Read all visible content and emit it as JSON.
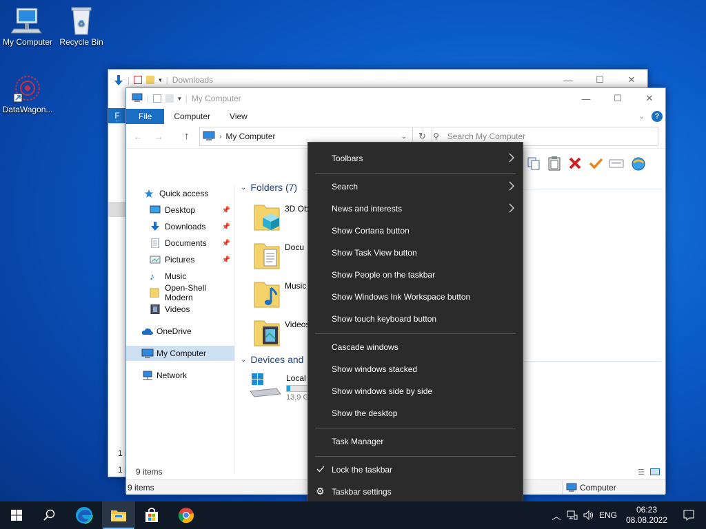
{
  "desktop": {
    "icons": [
      {
        "label": "My Computer"
      },
      {
        "label": "Recycle Bin"
      },
      {
        "label": "DataWagon..."
      }
    ]
  },
  "back_window": {
    "title": "Downloads",
    "tab_file_partial": "F",
    "status": "1 ite",
    "status2": "1 i"
  },
  "explorer": {
    "title": "My Computer",
    "tabs": [
      "File",
      "Computer",
      "View"
    ],
    "address_path": "My Computer",
    "search_placeholder": "Search My Computer",
    "sidebar": {
      "items": [
        {
          "label": "Quick access",
          "icon": "star-icon"
        },
        {
          "label": "Desktop",
          "icon": "desktop-folder-icon",
          "pinned": true
        },
        {
          "label": "Downloads",
          "icon": "download-icon",
          "pinned": true
        },
        {
          "label": "Documents",
          "icon": "documents-icon",
          "pinned": true
        },
        {
          "label": "Pictures",
          "icon": "pictures-icon",
          "pinned": true
        },
        {
          "label": "Music",
          "icon": "music-icon"
        },
        {
          "label": "Open-Shell Modern",
          "icon": "folder-icon"
        },
        {
          "label": "Videos",
          "icon": "videos-icon"
        },
        {
          "label": "OneDrive",
          "icon": "cloud-icon"
        },
        {
          "label": "My Computer",
          "icon": "computer-icon",
          "selected": true
        },
        {
          "label": "Network",
          "icon": "network-icon"
        }
      ]
    },
    "folders_header": "Folders (7)",
    "folders": [
      {
        "label": "3D Obj",
        "icon": "3d-objects-folder-icon"
      },
      {
        "label": "Docu",
        "icon": "documents-folder-icon"
      },
      {
        "label": "Music",
        "icon": "music-folder-icon"
      },
      {
        "label": "Videos",
        "icon": "videos-folder-icon"
      }
    ],
    "devices_header": "Devices and",
    "drive": {
      "label": "Local",
      "size": "13,9 G",
      "fill": 0.15
    },
    "status_items": "9 items",
    "status_items2": "9 items",
    "status_location": "Computer"
  },
  "context_menu": {
    "items": [
      {
        "label": "Toolbars",
        "submenu": true
      },
      {
        "label": "Search",
        "submenu": true
      },
      {
        "label": "News and interests",
        "submenu": true
      },
      {
        "label": "Show Cortana button"
      },
      {
        "label": "Show Task View button"
      },
      {
        "label": "Show People on the taskbar"
      },
      {
        "label": "Show Windows Ink Workspace button"
      },
      {
        "label": "Show touch keyboard button"
      },
      {
        "label": "Cascade windows"
      },
      {
        "label": "Show windows stacked"
      },
      {
        "label": "Show windows side by side"
      },
      {
        "label": "Show the desktop"
      },
      {
        "label": "Task Manager"
      },
      {
        "label": "Lock the taskbar",
        "checked": true
      },
      {
        "label": "Taskbar settings",
        "icon": "gear-icon"
      }
    ]
  },
  "taskbar": {
    "language": "ENG",
    "time": "06:23",
    "date": "08.08.2022"
  },
  "colors": {
    "accent": "#1a6fc4",
    "menu_bg": "#2b2b2b",
    "taskbar_bg": "#0f1a26",
    "selection": "#cce4f7"
  }
}
